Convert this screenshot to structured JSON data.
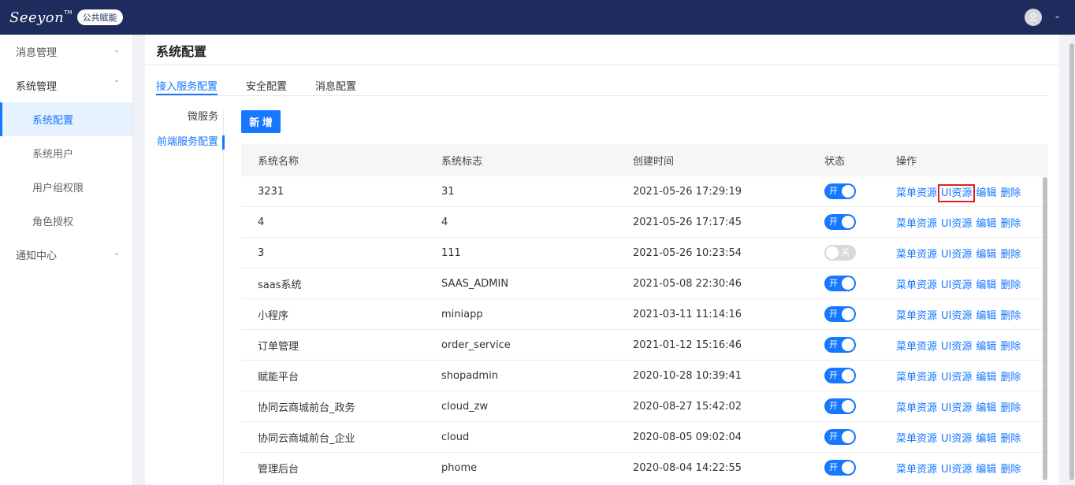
{
  "header": {
    "logo_text": "Seeyon",
    "logo_tm": "TM",
    "logo_badge": "公共赋能",
    "user_caret": "⌄"
  },
  "sidebar": {
    "items": [
      {
        "label": "消息管理",
        "chevron": "⌄"
      },
      {
        "label": "系统管理",
        "chevron": "⌃"
      },
      {
        "label": "系统配置"
      },
      {
        "label": "系统用户"
      },
      {
        "label": "用户组权限"
      },
      {
        "label": "角色授权"
      },
      {
        "label": "通知中心",
        "chevron": "⌄"
      }
    ]
  },
  "main": {
    "title": "系统配置",
    "tabs": [
      "接入服务配置",
      "安全配置",
      "消息配置"
    ],
    "subnav": [
      "微服务",
      "前端服务配置"
    ],
    "add_button": "新 增",
    "columns": [
      "系统名称",
      "系统标志",
      "创建时间",
      "状态",
      "操作"
    ],
    "status_on": "开",
    "status_off": "关",
    "actions": [
      "菜单资源",
      "UI资源",
      "编辑",
      "删除"
    ],
    "rows": [
      {
        "name": "3231",
        "code": "31",
        "created": "2021-05-26 17:29:19",
        "on": true
      },
      {
        "name": "4",
        "code": "4",
        "created": "2021-05-26 17:17:45",
        "on": true
      },
      {
        "name": "3",
        "code": "111",
        "created": "2021-05-26 10:23:54",
        "on": false
      },
      {
        "name": "saas系统",
        "code": "SAAS_ADMIN",
        "created": "2021-05-08 22:30:46",
        "on": true
      },
      {
        "name": "小程序",
        "code": "miniapp",
        "created": "2021-03-11 11:14:16",
        "on": true
      },
      {
        "name": "订单管理",
        "code": "order_service",
        "created": "2021-01-12 15:16:46",
        "on": true
      },
      {
        "name": "赋能平台",
        "code": "shopadmin",
        "created": "2020-10-28 10:39:41",
        "on": true
      },
      {
        "name": "协同云商城前台_政务",
        "code": "cloud_zw",
        "created": "2020-08-27 15:42:02",
        "on": true
      },
      {
        "name": "协同云商城前台_企业",
        "code": "cloud",
        "created": "2020-08-05 09:02:04",
        "on": true
      },
      {
        "name": "管理后台",
        "code": "phome",
        "created": "2020-08-04 14:22:55",
        "on": true
      }
    ]
  },
  "colors": {
    "header_bg": "#1d2c5c",
    "accent": "#1677ff",
    "highlight": "#e02020"
  }
}
